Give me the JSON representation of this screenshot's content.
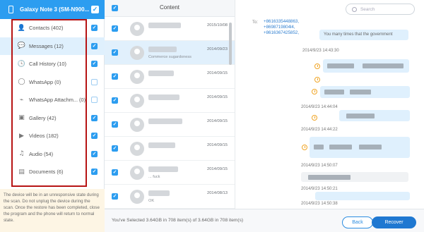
{
  "device": {
    "name": "Galaxy Note 3 (SM-N900..."
  },
  "categories": [
    {
      "label": "Contacts (402)",
      "icon": "contacts-icon",
      "checked": true
    },
    {
      "label": "Messages (12)",
      "icon": "messages-icon",
      "checked": true,
      "selected": true
    },
    {
      "label": "Call History (10)",
      "icon": "call-history-icon",
      "checked": true
    },
    {
      "label": "WhatsApp (0)",
      "icon": "whatsapp-icon",
      "checked": false
    },
    {
      "label": "WhatsApp Attachm... (0)",
      "icon": "attachment-icon",
      "checked": false
    },
    {
      "label": "Gallery (42)",
      "icon": "gallery-icon",
      "checked": true
    },
    {
      "label": "Videos (182)",
      "icon": "videos-icon",
      "checked": true
    },
    {
      "label": "Audio (54)",
      "icon": "audio-icon",
      "checked": true
    },
    {
      "label": "Documents (6)",
      "icon": "documents-icon",
      "checked": true
    }
  ],
  "warning": "The device will be in an unresponsive state during the scan. Do not unplug the device during the scan. Once the restore has been completed, close the program and the phone will return to normal state.",
  "list": {
    "header": "Content",
    "rows": [
      {
        "date": "2015/10/08",
        "sub": ""
      },
      {
        "date": "2014/09/23",
        "sub": "Commerce sugardoness",
        "selected": true
      },
      {
        "date": "2014/09/15",
        "sub": ""
      },
      {
        "date": "2014/09/15",
        "sub": ""
      },
      {
        "date": "2014/09/15",
        "sub": ""
      },
      {
        "date": "2014/09/15",
        "sub": ""
      },
      {
        "date": "2014/09/15",
        "sub": "... fuck"
      },
      {
        "date": "2014/08/13",
        "sub": "OK"
      },
      {
        "date": "2014/08/13",
        "sub": ""
      }
    ]
  },
  "chat": {
    "to_label": "To:",
    "recipients": [
      "+8616335448863,",
      "+8698719804l4,",
      "+8616367425852,"
    ],
    "search_placeholder": "Search",
    "first_message": "You many times that the government",
    "timestamps": [
      "2014/9/23 14:43:30",
      "2014/9/23 14:44:04",
      "2014/9/23 14:44:22",
      "2014/9/23 14:50:07",
      "2014/9/23 14:50:21",
      "2014/9/23 14:50:38"
    ]
  },
  "footer": {
    "summary": "You've Selected 3.64GB in 708 item(s) of 3.64GB in 708 item(s)",
    "back": "Back",
    "recover": "Recover"
  },
  "colors": {
    "accent": "#2c9df0",
    "recover": "#1f78d1",
    "highlight": "#b71414",
    "warning_bg": "#fdf5e4"
  }
}
